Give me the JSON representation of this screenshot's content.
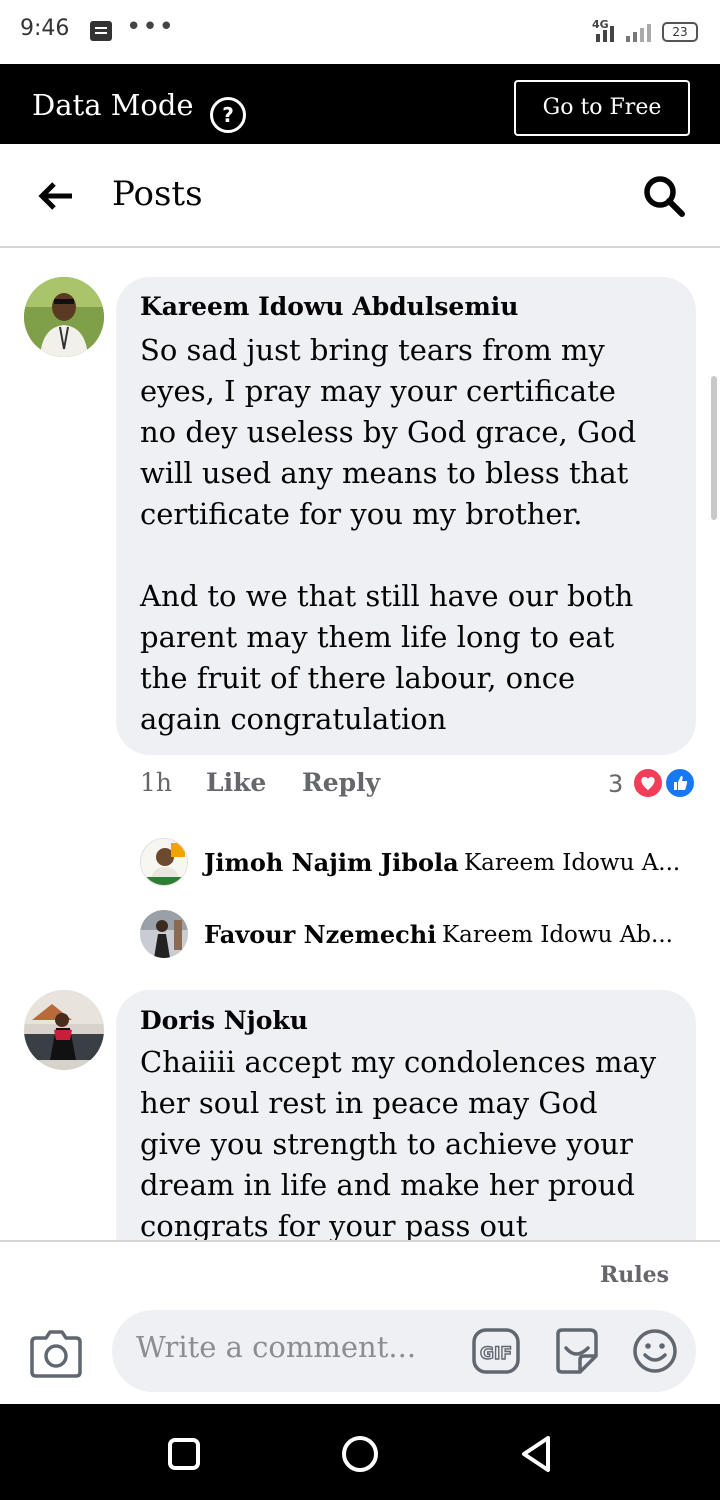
{
  "status_bar": {
    "time": "9:46",
    "dots": "•••",
    "network": "4G",
    "battery": "23"
  },
  "data_mode": {
    "title": "Data Mode",
    "help_icon": "question-circle-icon",
    "go_free_label": "Go to Free"
  },
  "header": {
    "title": "Posts",
    "back_icon": "arrow-left-icon",
    "search_icon": "search-icon"
  },
  "comments": [
    {
      "author": "Kareem Idowu Abdulsemiu",
      "lines": [
        "So sad just bring tears from my",
        "eyes, I pray may your certificate",
        "no dey useless by God grace, God",
        "will used any means to bless that",
        "certificate for you my brother.",
        "",
        "And to we that still have our both",
        "parent may them life long to eat",
        "the fruit of there labour, once",
        "again congratulation"
      ],
      "time": "1h",
      "like_label": "Like",
      "reply_label": "Reply",
      "reaction_count": "3",
      "reactions": [
        "love-reaction-icon",
        "like-reaction-icon"
      ],
      "replies": [
        {
          "author": "Jimoh Najim Jibola",
          "snippet": "Kareem Idowu A..."
        },
        {
          "author": "Favour Nzemechi",
          "snippet": "Kareem Idowu Ab..."
        }
      ]
    },
    {
      "author": "Doris Njoku",
      "lines": [
        "Chaiiii accept my condolences may",
        "her soul rest in peace may God",
        "give you strength to achieve your",
        "dream in life and make her proud",
        "congrats for your pass out"
      ]
    }
  ],
  "footer": {
    "rules_label": "Rules",
    "comment_placeholder": "Write a comment...",
    "icons": [
      "camera-icon",
      "gif-icon",
      "sticker-icon",
      "emoji-icon"
    ]
  },
  "colors": {
    "data_bar": "#000000",
    "bubble": "#eff0f3",
    "meta_text": "#65676b",
    "love": "#f33e58",
    "like": "#1877f2"
  }
}
